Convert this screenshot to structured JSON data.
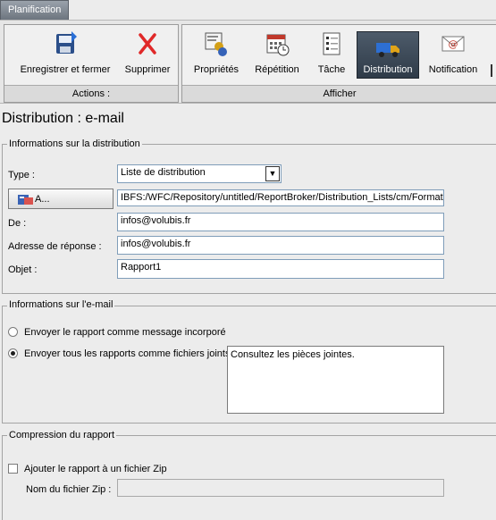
{
  "tab": {
    "label": "Planification"
  },
  "ribbon": {
    "actions_group": {
      "title": "Actions :",
      "buttons": [
        {
          "label": "Enregistrer et fermer",
          "icon": "save-close-icon"
        },
        {
          "label": "Supprimer",
          "icon": "delete-icon"
        }
      ]
    },
    "view_group": {
      "title": "Afficher",
      "buttons": [
        {
          "label": "Propriétés",
          "icon": "properties-icon"
        },
        {
          "label": "Répétition",
          "icon": "calendar-icon"
        },
        {
          "label": "Tâche",
          "icon": "task-list-icon"
        },
        {
          "label": "Distribution",
          "icon": "truck-icon"
        },
        {
          "label": "Notification",
          "icon": "email-notification-icon"
        }
      ]
    }
  },
  "page": {
    "title": "Distribution : e-mail"
  },
  "distribution": {
    "legend": "Informations sur la distribution",
    "type_label": "Type :",
    "type_value": "Liste de distribution",
    "to_button": "A...",
    "to_value": "IBFS:/WFC/Repository/untitled/ReportBroker/Distribution_Lists/cm/Formatio",
    "from_label": "De :",
    "from_value": "infos@volubis.fr",
    "reply_label": "Adresse de réponse :",
    "reply_value": "infos@volubis.fr",
    "subject_label": "Objet :",
    "subject_value": "Rapport1"
  },
  "email": {
    "legend": "Informations sur l'e-mail",
    "option_inline": "Envoyer le rapport comme message incorporé",
    "option_attach": "Envoyer tous les rapports comme fichiers joints",
    "selected": "attach",
    "body_text": "Consultez les pièces jointes."
  },
  "compression": {
    "legend": "Compression du rapport",
    "zip_checkbox": "Ajouter le rapport à un fichier Zip",
    "zip_checked": false,
    "zip_name_label": "Nom du fichier Zip :",
    "zip_name_value": ""
  },
  "colors": {
    "active_button": "#2f3b48",
    "tab": "#6d757f"
  }
}
